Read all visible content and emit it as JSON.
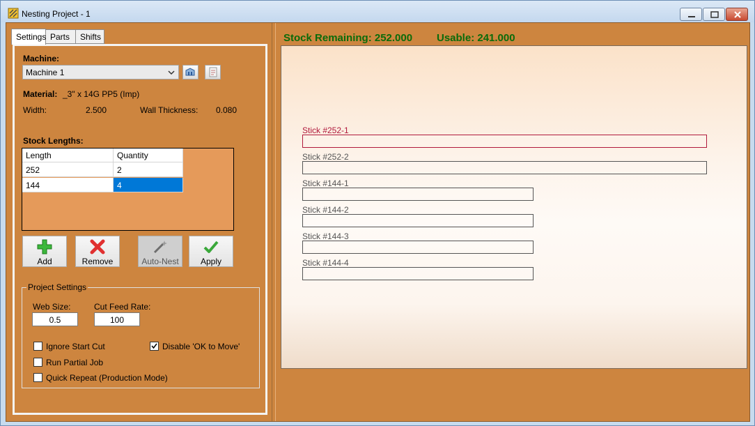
{
  "window": {
    "title": "Nesting Project - 1"
  },
  "tabs": [
    "Settings",
    "Parts",
    "Shifts"
  ],
  "settings": {
    "machine_label": "Machine:",
    "machine_value": "Machine 1",
    "material_label": "Material:",
    "material_value": "_3\" x 14G PP5 (Imp)",
    "width_label": "Width:",
    "width_value": "2.500",
    "wall_label": "Wall Thickness:",
    "wall_value": "0.080",
    "stock_lengths_label": "Stock Lengths:",
    "grid": {
      "headers": [
        "Length",
        "Quantity"
      ],
      "rows": [
        [
          "252",
          "2"
        ],
        [
          "144",
          "4"
        ]
      ]
    },
    "buttons": {
      "add": "Add",
      "remove": "Remove",
      "autonest": "Auto-Nest",
      "apply": "Apply"
    },
    "project": {
      "title": "Project Settings",
      "web_size_label": "Web Size:",
      "web_size_value": "0.5",
      "feed_label": "Cut Feed Rate:",
      "feed_value": "100",
      "ignore_start": "Ignore Start Cut",
      "disable_ok": "Disable 'OK to Move'",
      "run_partial": "Run Partial Job",
      "quick_repeat": "Quick Repeat (Production Mode)"
    }
  },
  "status": {
    "stock_remaining": "Stock Remaining: 252.000",
    "usable": "Usable: 241.000"
  },
  "sticks": [
    {
      "label": "Stick  #252-1",
      "length": 252,
      "selected": true
    },
    {
      "label": "Stick  #252-2",
      "length": 252,
      "selected": false
    },
    {
      "label": "Stick  #144-1",
      "length": 144,
      "selected": false
    },
    {
      "label": "Stick  #144-2",
      "length": 144,
      "selected": false
    },
    {
      "label": "Stick  #144-3",
      "length": 144,
      "selected": false
    },
    {
      "label": "Stick  #144-4",
      "length": 144,
      "selected": false
    }
  ],
  "colors": {
    "panel": "#cd853f",
    "status_text": "#0a6b0a",
    "selected_stick": "#b0193c",
    "selection": "#0078d7"
  }
}
